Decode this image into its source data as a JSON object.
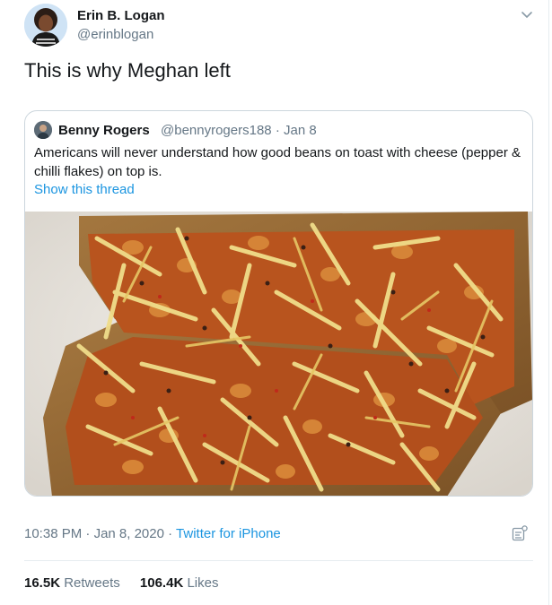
{
  "author": {
    "name": "Erin B. Logan",
    "handle": "@erinblogan"
  },
  "tweet": {
    "text": "This is why Meghan left"
  },
  "quoted": {
    "name": "Benny Rogers",
    "handle": "@bennyrogers188",
    "separator": "·",
    "date": "Jan 8",
    "text": "Americans will never understand how good beans on toast with cheese (pepper & chilli flakes) on top is.",
    "show_thread": "Show this thread"
  },
  "meta": {
    "time": "10:38 PM",
    "dot1": "·",
    "date": "Jan 8, 2020",
    "dot2": "·",
    "source": "Twitter for iPhone"
  },
  "stats": {
    "retweets_count": "16.5K",
    "retweets_label": "Retweets",
    "likes_count": "106.4K",
    "likes_label": "Likes"
  },
  "icons": {
    "caret": "chevron-down-icon",
    "analytics": "tweet-analytics-icon"
  },
  "colors": {
    "link": "#1b95e0",
    "secondary_text": "#657786",
    "primary_text": "#14171a"
  }
}
